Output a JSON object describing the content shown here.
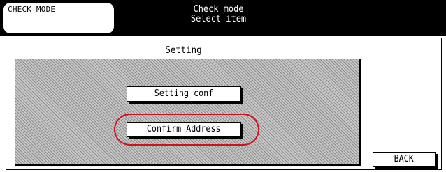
{
  "header": {
    "mode_tab_label": "CHECK MODE",
    "title_line1": "Check mode",
    "title_line2": "Select item"
  },
  "main": {
    "section_label": "Setting",
    "buttons": {
      "setting_conf": "Setting conf",
      "confirm_address": "Confirm Address"
    },
    "highlight_color": "#d0121e"
  },
  "footer": {
    "back_label": "BACK"
  }
}
